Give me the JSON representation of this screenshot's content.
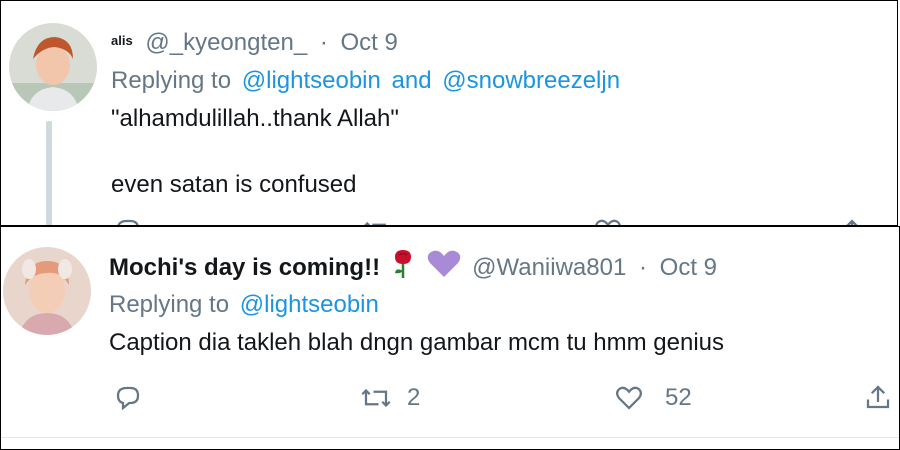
{
  "tweet1": {
    "display_name": "alis",
    "handle": "@_kyeongten_",
    "separator": "·",
    "date": "Oct 9",
    "replying_prefix": "Replying to",
    "reply_user_1": "@lightseobin",
    "reply_joiner": "and",
    "reply_user_2": "@snowbreezeljn",
    "line1": "\"alhamdulillah..thank Allah\"",
    "line2": "even satan is confused",
    "avatar_icon": "person-photo-avatar"
  },
  "tweet2": {
    "display_name": "Mochi's day is coming!!",
    "name_emojis": [
      "rose-emoji",
      "purple-heart-emoji"
    ],
    "handle": "@Waniiwa801",
    "separator": "·",
    "date": "Oct 9",
    "replying_prefix": "Replying to",
    "reply_user_1": "@lightseobin",
    "body": "Caption dia takleh blah dngn gambar mcm tu hmm genius",
    "retweet_count": "2",
    "like_count": "52",
    "avatar_icon": "person-photo-avatar",
    "actions": [
      "reply-icon",
      "retweet-icon",
      "like-icon",
      "share-icon"
    ]
  },
  "colors": {
    "link": "#1b95e0",
    "muted": "#657786",
    "text": "#14171a",
    "thread_line": "#cfd9de",
    "rose": "#c8102e",
    "purple_heart": "#a98ad6"
  }
}
